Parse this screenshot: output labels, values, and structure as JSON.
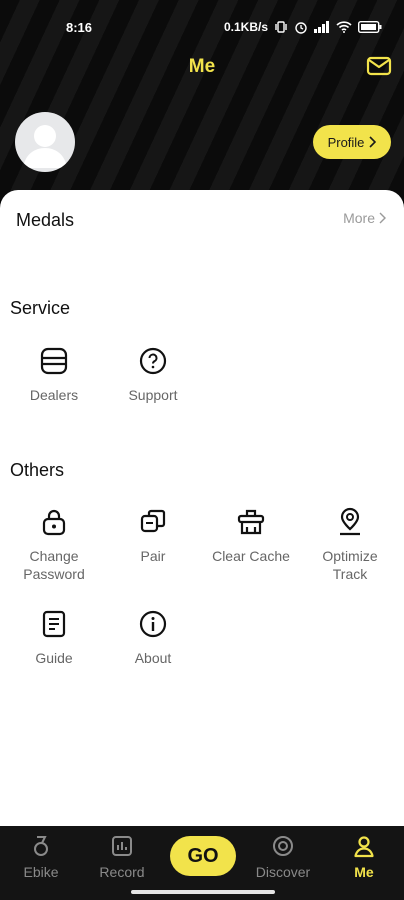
{
  "status_bar": {
    "time": "8:16",
    "network_speed": "0.1KB/s"
  },
  "header": {
    "title": "Me",
    "profile_button": "Profile"
  },
  "medals": {
    "title": "Medals",
    "more": "More"
  },
  "service": {
    "title": "Service",
    "items": [
      {
        "label": "Dealers",
        "icon": "dealers-icon"
      },
      {
        "label": "Support",
        "icon": "support-icon"
      }
    ]
  },
  "others": {
    "title": "Others",
    "items": [
      {
        "label": "Change\nPassword",
        "icon": "lock-icon"
      },
      {
        "label": "Pair",
        "icon": "pair-icon"
      },
      {
        "label": "Clear Cache",
        "icon": "clear-cache-icon"
      },
      {
        "label": "Optimize\nTrack",
        "icon": "location-pin-icon"
      },
      {
        "label": "Guide",
        "icon": "guide-icon"
      },
      {
        "label": "About",
        "icon": "info-icon"
      }
    ]
  },
  "tabbar": {
    "tabs": [
      {
        "label": "Ebike",
        "icon": "ebike-icon"
      },
      {
        "label": "Record",
        "icon": "record-icon"
      },
      {
        "label": "GO",
        "icon": "go-button"
      },
      {
        "label": "Discover",
        "icon": "discover-icon"
      },
      {
        "label": "Me",
        "icon": "person-icon"
      }
    ],
    "active": "Me"
  },
  "colors": {
    "accent": "#f2e34b",
    "background_dark": "#0b0b0b",
    "tabbar": "#141414"
  }
}
